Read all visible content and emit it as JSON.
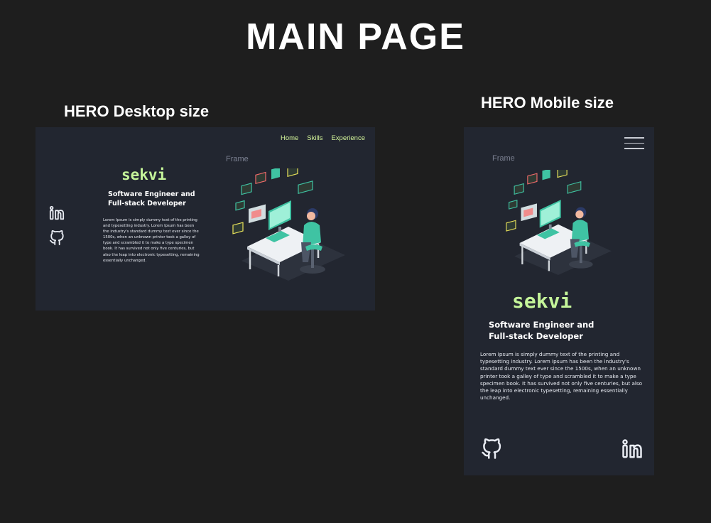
{
  "page": {
    "title": "MAIN PAGE"
  },
  "desktop": {
    "section_label": "HERO Desktop size",
    "frame_label": "Frame",
    "nav": [
      {
        "label": "Home"
      },
      {
        "label": "Skills"
      },
      {
        "label": "Experience"
      }
    ],
    "brand": "sekvi",
    "role_line1": "Software Engineer and",
    "role_line2": "Full-stack Developer",
    "description": "Lorem Ipsum is simply dummy text of the printing and typesetting industry. Lorem Ipsum has been the industry's standard dummy text ever since the 1500s, when an unknown printer took a galley of type and scrambled it to make a type specimen book. It has survived not only five centuries, but also the leap into electronic typesetting, remaining essentially unchanged.",
    "icons": [
      "linkedin-icon",
      "github-icon"
    ]
  },
  "mobile": {
    "section_label": "HERO Mobile size",
    "frame_label": "Frame",
    "brand": "sekvi",
    "role_line1": "Software Engineer and",
    "role_line2": "Full-stack Developer",
    "description": "Lorem Ipsum is simply dummy text of the printing and typesetting industry. Lorem Ipsum has been the industry's standard dummy text ever since the 1500s, when an unknown printer took a galley of type and scrambled it to make a type specimen book. It has survived not only five centuries, but also the leap into electronic typesetting, remaining essentially unchanged.",
    "icons": [
      "hamburger-menu-icon",
      "github-icon",
      "linkedin-icon"
    ]
  },
  "colors": {
    "canvas": "#1e1e1e",
    "frame": "#222630",
    "accent": "#c5f59a",
    "illustration_teal": "#3fc3a3"
  }
}
